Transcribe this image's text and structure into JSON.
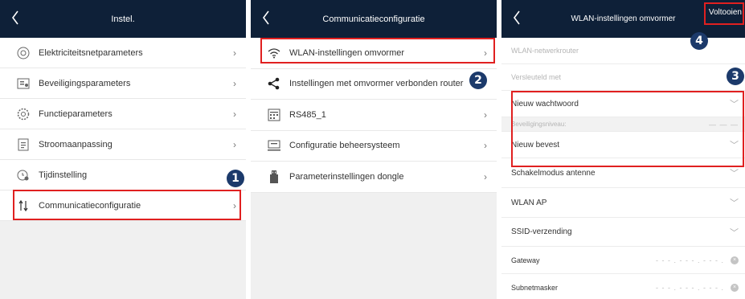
{
  "panel1": {
    "title": "Instel.",
    "items": [
      {
        "label": "Elektriciteitsnetparameters",
        "icon": "grid-params-icon"
      },
      {
        "label": "Beveiligingsparameters",
        "icon": "protection-params-icon"
      },
      {
        "label": "Functieparameters",
        "icon": "function-params-icon"
      },
      {
        "label": "Stroomaanpassing",
        "icon": "power-adjust-icon"
      },
      {
        "label": "Tijdinstelling",
        "icon": "time-setting-icon"
      },
      {
        "label": "Communicatieconfiguratie",
        "icon": "communication-icon"
      }
    ],
    "badge": "1"
  },
  "panel2": {
    "title": "Communicatieconfiguratie",
    "items": [
      {
        "label": "WLAN-instellingen omvormer",
        "icon": "wifi-icon"
      },
      {
        "label": "Instellingen met omvormer verbonden router",
        "icon": "share-icon"
      },
      {
        "label": "RS485_1",
        "icon": "rs485-icon"
      },
      {
        "label": "Configuratie beheersysteem",
        "icon": "management-system-icon"
      },
      {
        "label": "Parameterinstellingen dongle",
        "icon": "dongle-icon"
      }
    ],
    "badge": "2"
  },
  "panel3": {
    "title": "WLAN-instellingen omvormer",
    "done_label": "Voltooien",
    "rows": {
      "network_router": "WLAN-netwerkrouter",
      "encrypted": "Versleuteld met",
      "new_password": "Nieuw wachtwoord",
      "security_level": "Beveiligingsniveau:",
      "confirm_new": "Nieuw bevest",
      "antenna_mode": "Schakelmodus antenne",
      "wlan_ap": "WLAN AP",
      "ssid_broadcast": "SSID-verzending",
      "gateway": "Gateway",
      "subnet_mask": "Subnetmasker"
    },
    "badge3": "3",
    "badge4": "4"
  },
  "colors": {
    "header_bg": "#0e2038",
    "highlight_red": "#e02020",
    "badge_bg": "#1c3a6b"
  }
}
